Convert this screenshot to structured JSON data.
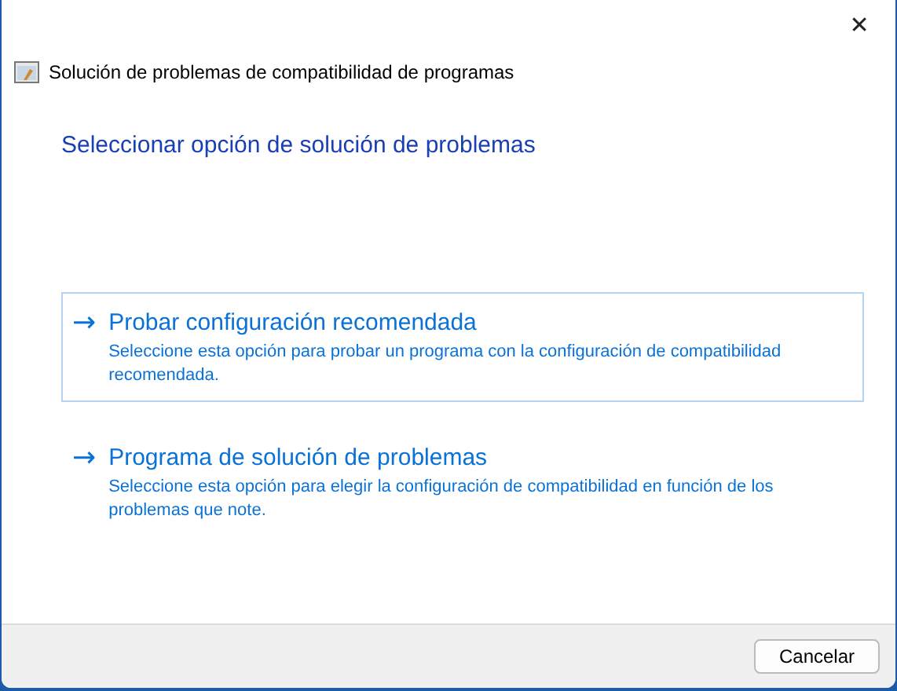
{
  "window": {
    "title": "Solución de problemas de compatibilidad de programas",
    "close": "✕"
  },
  "heading": "Seleccionar opción de solución de problemas",
  "options": [
    {
      "arrow": "→",
      "title": "Probar configuración recomendada",
      "description": "Seleccione esta opción para probar un programa con la configuración de compatibilidad recomendada.",
      "selected": true
    },
    {
      "arrow": "→",
      "title": "Programa de solución de problemas",
      "description": "Seleccione esta opción para elegir la configuración de compatibilidad en función de los problemas que note.",
      "selected": false
    }
  ],
  "buttons": [
    "Cancelar"
  ]
}
